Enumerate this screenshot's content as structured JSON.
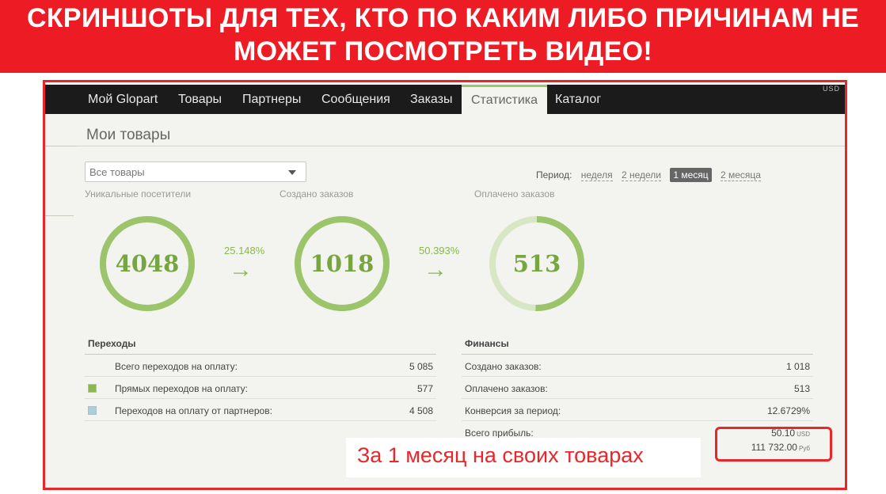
{
  "banner": {
    "line1": "СКРИНШОТЫ ДЛЯ ТЕХ, КТО ПО КАКИМ ЛИБО ПРИЧИНАМ НЕ",
    "line2": "МОЖЕТ ПОСМОТРЕТЬ ВИДЕО!",
    "color": "#ed1c24"
  },
  "nav": {
    "items": [
      {
        "label": "Мой Glopart"
      },
      {
        "label": "Товары"
      },
      {
        "label": "Партнеры"
      },
      {
        "label": "Сообщения"
      },
      {
        "label": "Заказы"
      },
      {
        "label": "Статистика",
        "active": true
      },
      {
        "label": "Каталог"
      }
    ],
    "corner_currency": "USD"
  },
  "page": {
    "title": "Мои товары"
  },
  "filter": {
    "selected": "Все товары",
    "icon": "chevron-down-icon"
  },
  "period": {
    "label": "Период:",
    "options": [
      "неделя",
      "2 недели",
      "1 месяц",
      "2 месяца"
    ],
    "active": "1 месяц"
  },
  "funnel": {
    "visitors": {
      "label": "Уникальные посетители",
      "value": "4048",
      "ring_fill": 1.0
    },
    "created": {
      "label": "Создано заказов",
      "value": "1018",
      "ring_fill": 1.0
    },
    "paid": {
      "label": "Оплачено заказов",
      "value": "513",
      "ring_fill": 0.504
    },
    "conv1": {
      "percent": "25.148%",
      "arrow": "→"
    },
    "conv2": {
      "percent": "50.393%",
      "arrow": "→"
    },
    "ring_color": "#9cc46b",
    "ring_track_color": "#d7e6c3"
  },
  "transitions": {
    "title": "Переходы",
    "rows": [
      {
        "label": "Всего переходов на оплату:",
        "value": "5 085"
      },
      {
        "label": "Прямых переходов на оплату:",
        "value": "577",
        "swatch": "#8ab74f"
      },
      {
        "label": "Переходов на оплату от партнеров:",
        "value": "4 508",
        "swatch": "#a9cfd9"
      }
    ]
  },
  "finance": {
    "title": "Финансы",
    "rows": [
      {
        "label": "Создано заказов:",
        "value": "1 018"
      },
      {
        "label": "Оплачено заказов:",
        "value": "513"
      },
      {
        "label": "Конверсия за период:",
        "value": "12.6729%"
      }
    ],
    "profit_label": "Всего прибыль:",
    "profit_usd": "50.10",
    "profit_usd_cur": "USD",
    "profit_rub": "111 732.00",
    "profit_rub_cur": "Руб"
  },
  "callout": {
    "text": "За 1 месяц на своих товарах",
    "color": "#e8272b"
  }
}
